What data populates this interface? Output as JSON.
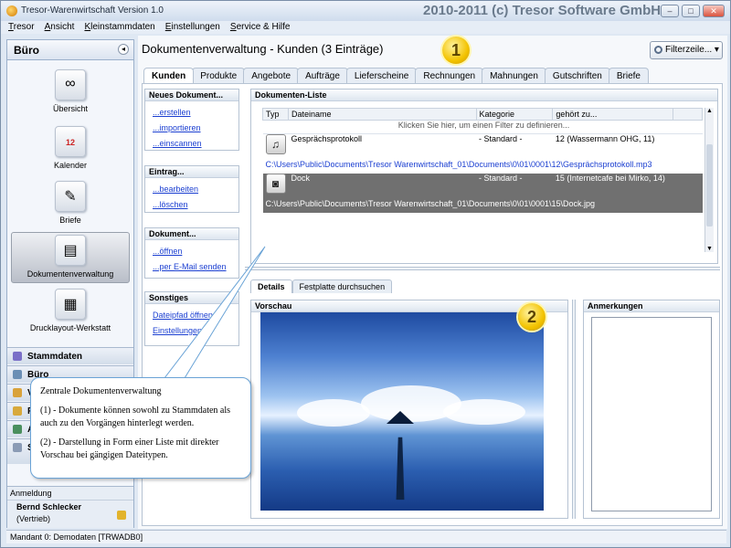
{
  "app": {
    "title": "Tresor-Warenwirtschaft Version 1.0",
    "brand": "2010-2011 (c) Tresor Software GmbH"
  },
  "menu": [
    "Tresor",
    "Ansicht",
    "Kleinstammdaten",
    "Einstellungen",
    "Service & Hilfe"
  ],
  "sidebar": {
    "title": "Büro",
    "items": [
      {
        "label": "Übersicht",
        "icon": "overview-icon"
      },
      {
        "label": "Kalender",
        "icon": "calendar-icon",
        "badge": "12"
      },
      {
        "label": "Briefe",
        "icon": "letter-icon"
      },
      {
        "label": "Dokumentenverwaltung",
        "icon": "documents-icon"
      },
      {
        "label": "Drucklayout-Werkstatt",
        "icon": "print-layout-icon"
      }
    ],
    "sections": [
      "Stammdaten",
      "Büro",
      "V",
      "F",
      "A",
      "S"
    ],
    "login": {
      "title": "Anmeldung",
      "user": "Bernd Schlecker",
      "role": "(Vertrieb)"
    }
  },
  "status": "Mandant 0: Demodaten [TRWADB0]",
  "main": {
    "title": "Dokumentenverwaltung - Kunden (3 Einträge)",
    "filter_button": "Filterzeile...",
    "badge1": "1",
    "badge2": "2",
    "tabs": [
      "Kunden",
      "Produkte",
      "Angebote",
      "Aufträge",
      "Lieferscheine",
      "Rechnungen",
      "Mahnungen",
      "Gutschriften",
      "Briefe"
    ],
    "actions": {
      "neues": {
        "title": "Neues Dokument...",
        "links": [
          "...erstellen",
          "...importieren",
          "...einscannen"
        ]
      },
      "eintrag": {
        "title": "Eintrag...",
        "links": [
          "...bearbeiten",
          "...löschen"
        ]
      },
      "dokument": {
        "title": "Dokument...",
        "links": [
          "...öffnen",
          "...per E-Mail senden"
        ]
      },
      "sonstiges": {
        "title": "Sonstiges",
        "links": [
          "Dateipfad öffnen",
          "Einstellungen"
        ]
      }
    },
    "list": {
      "title": "Dokumenten-Liste",
      "columns": [
        "Typ",
        "Dateiname",
        "Kategorie",
        "gehört zu..."
      ],
      "filter_hint": "Klicken Sie hier, um einen Filter zu definieren...",
      "rows": [
        {
          "type": "MP3",
          "name": "Gesprächsprotokoll",
          "category": "- Standard -",
          "belongs": "12 (Wassermann OHG, 11)",
          "path": "C:\\Users\\Public\\Documents\\Tresor Warenwirtschaft_01\\Documents\\0\\01\\0001\\12\\Gesprächsprotokoll.mp3"
        },
        {
          "type": "JPG",
          "name": "Dock",
          "category": "- Standard -",
          "belongs": "15 (Internetcafe bei Mirko, 14)",
          "path": "C:\\Users\\Public\\Documents\\Tresor Warenwirtschaft_01\\Documents\\0\\01\\0001\\15\\Dock.jpg"
        }
      ]
    },
    "subtabs": [
      "Details",
      "Festplatte durchsuchen"
    ],
    "preview": {
      "title": "Vorschau"
    },
    "notes": {
      "title": "Anmerkungen"
    }
  },
  "callout": {
    "heading": "Zentrale Dokumentenverwaltung",
    "p1": "(1) - Dokumente können sowohl zu Stammdaten als auch zu den Vorgängen hinterlegt werden.",
    "p2": "(2) - Darstellung in Form einer Liste mit direkter Vorschau bei gängigen Dateitypen."
  }
}
